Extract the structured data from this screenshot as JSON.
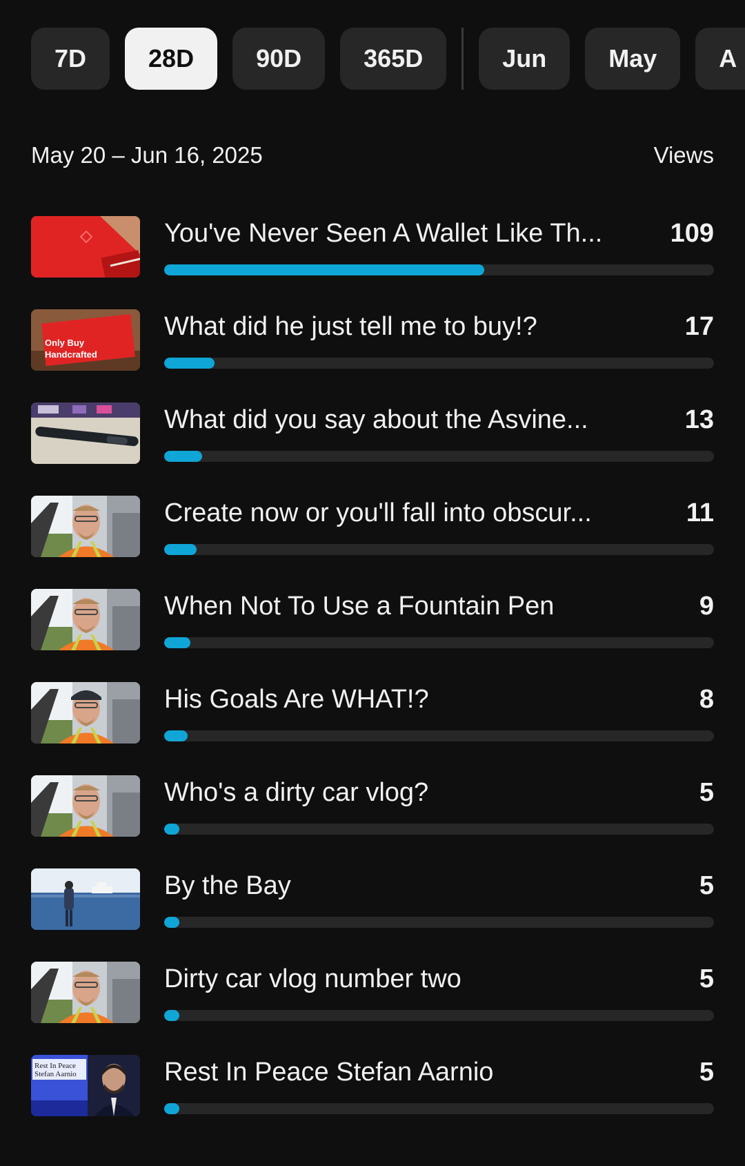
{
  "period_chips": [
    {
      "label": "7D",
      "active": false
    },
    {
      "label": "28D",
      "active": true
    },
    {
      "label": "90D",
      "active": false
    },
    {
      "label": "365D",
      "active": false
    }
  ],
  "month_chips": [
    {
      "label": "Jun",
      "active": false
    },
    {
      "label": "May",
      "active": false
    },
    {
      "label": "A",
      "active": false
    }
  ],
  "header": {
    "date_range": "May 20 – Jun 16, 2025",
    "metric_label": "Views"
  },
  "colors": {
    "bar_fill": "#0fa5d6",
    "bar_track": "#272727",
    "background": "#0f0f0f"
  },
  "videos": [
    {
      "title": "You've Never Seen A Wallet Like Th...",
      "views": "109",
      "progress": 0.582,
      "thumb_icon": "red-wallet-thumbnail",
      "thumb_text": ""
    },
    {
      "title": "What did he just tell me to buy!?",
      "views": "17",
      "progress": 0.092,
      "thumb_icon": "red-wallet-text-thumbnail",
      "thumb_text": "Only Buy Handcrafted"
    },
    {
      "title": "What did you say about the Asvine...",
      "views": "13",
      "progress": 0.069,
      "thumb_icon": "pen-on-carpet-thumbnail",
      "thumb_text": ""
    },
    {
      "title": "Create now or you'll fall into obscur...",
      "views": "11",
      "progress": 0.059,
      "thumb_icon": "man-in-car-thumbnail",
      "thumb_text": ""
    },
    {
      "title": "When Not To Use a Fountain Pen",
      "views": "9",
      "progress": 0.048,
      "thumb_icon": "man-in-car-thumbnail",
      "thumb_text": ""
    },
    {
      "title": "His Goals Are WHAT!?",
      "views": "8",
      "progress": 0.043,
      "thumb_icon": "man-in-car-cap-thumbnail",
      "thumb_text": ""
    },
    {
      "title": "Who's a dirty car vlog?",
      "views": "5",
      "progress": 0.027,
      "thumb_icon": "man-in-car-thumbnail",
      "thumb_text": ""
    },
    {
      "title": "By the Bay",
      "views": "5",
      "progress": 0.027,
      "thumb_icon": "bay-water-thumbnail",
      "thumb_text": ""
    },
    {
      "title": "Dirty car vlog number two",
      "views": "5",
      "progress": 0.027,
      "thumb_icon": "man-in-car-thumbnail",
      "thumb_text": ""
    },
    {
      "title": "Rest In Peace Stefan Aarnio",
      "views": "5",
      "progress": 0.027,
      "thumb_icon": "memorial-portrait-thumbnail",
      "thumb_text": "Rest In Peace Stefan Aarnio"
    }
  ]
}
